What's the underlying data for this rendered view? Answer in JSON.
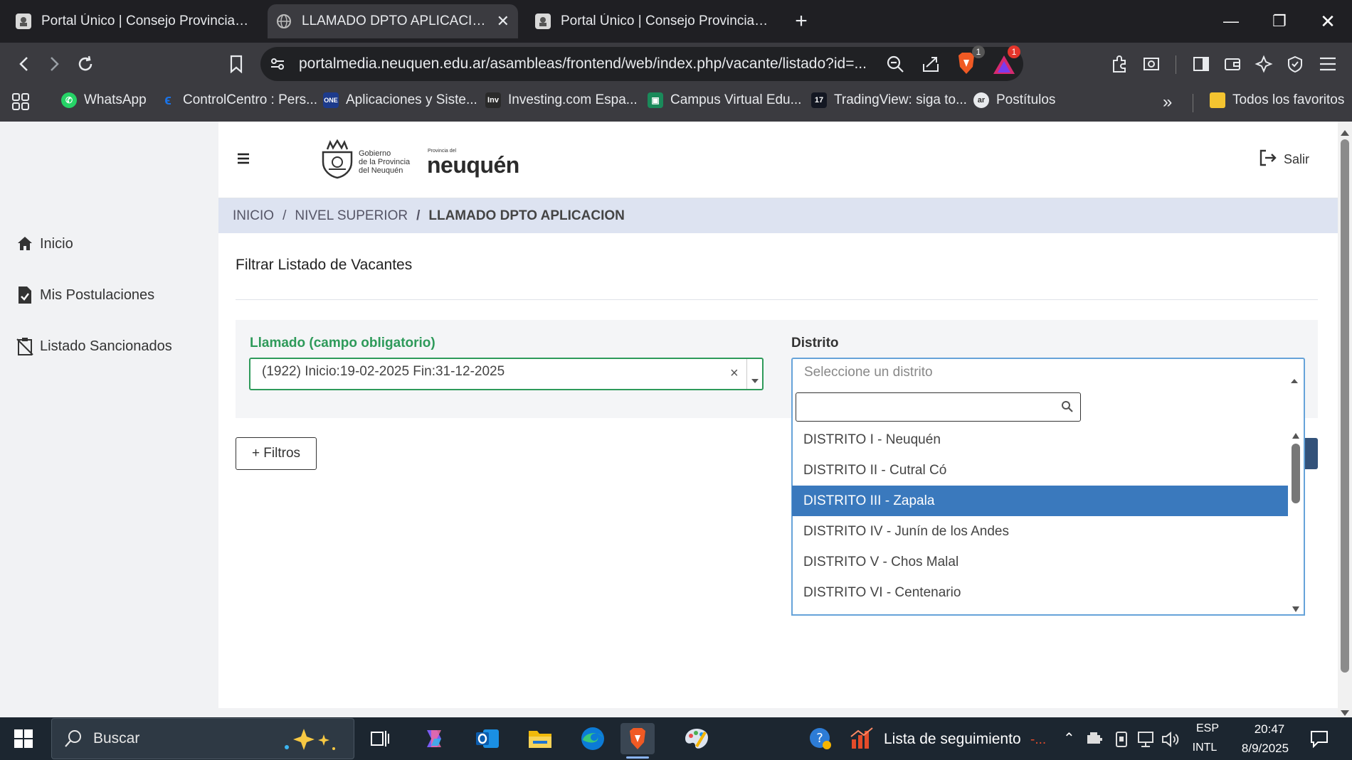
{
  "browser": {
    "tabs": [
      {
        "title": "Portal Único | Consejo Provincial de E",
        "active": false
      },
      {
        "title": "LLAMADO DPTO APLICACION",
        "active": true
      },
      {
        "title": "Portal Único | Consejo Provincial de E",
        "active": false
      }
    ],
    "url": "portalmedia.neuquen.edu.ar/asambleas/frontend/web/index.php/vacante/listado?id=...",
    "brave_badge": "1",
    "alert_badge": "1",
    "bookmarks": [
      {
        "label": "WhatsApp",
        "color": "#25d366"
      },
      {
        "label": "ControlCentro : Pers...",
        "color": "#1a73e8"
      },
      {
        "label": "Aplicaciones y Siste...",
        "color": "#1d3b8c"
      },
      {
        "label": "Investing.com Espa...",
        "color": "#222"
      },
      {
        "label": "Campus Virtual Edu...",
        "color": "#1a8a5a"
      },
      {
        "label": "TradingView: siga to...",
        "color": "#131722"
      },
      {
        "label": "Postítulos",
        "color": "#666"
      }
    ],
    "bookmarks_more": "»",
    "all_favorites": "Todos los favoritos"
  },
  "sidebar": {
    "items": [
      {
        "label": "Inicio"
      },
      {
        "label": "Mis Postulaciones"
      },
      {
        "label": "Listado Sancionados"
      }
    ]
  },
  "header": {
    "logo_gov_lines": [
      "Gobierno",
      "de la Provincia",
      "del Neuquén"
    ],
    "logo_prov_small": "Provincia del",
    "logo_prov": "neuquén",
    "logout": "Salir"
  },
  "breadcrumb": {
    "items": [
      "INICIO",
      "NIVEL SUPERIOR",
      "LLAMADO DPTO APLICACION"
    ],
    "separator": "/"
  },
  "filter": {
    "title": "Filtrar Listado de Vacantes",
    "llamado_label": "Llamado (campo obligatorio)",
    "llamado_value": "(1922) Inicio:19-02-2025 Fin:31-12-2025",
    "distrito_label": "Distrito",
    "distrito_placeholder": "Seleccione un distrito",
    "filtros_button": "+ Filtros",
    "options": [
      "DISTRITO I - Neuquén",
      "DISTRITO II - Cutral Có",
      "DISTRITO III - Zapala",
      "DISTRITO IV - Junín de los Andes",
      "DISTRITO V - Chos Malal",
      "DISTRITO VI - Centenario"
    ],
    "highlighted_option": "DISTRITO III - Zapala"
  },
  "taskbar": {
    "search_placeholder": "Buscar",
    "watchlist": "Lista de seguimiento",
    "watchlist_suffix": "-...",
    "lang_top": "ESP",
    "lang_bottom": "INTL",
    "time": "20:47",
    "date": "8/9/2025"
  },
  "colors": {
    "accent_green": "#2e9a5a",
    "highlight_blue": "#3a79bd",
    "breadcrumb_bg": "#dde3f1"
  }
}
